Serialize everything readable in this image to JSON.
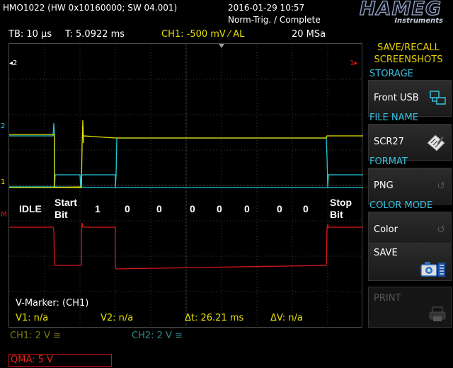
{
  "header": {
    "device": "HMO1022 (HW 0x10160000; SW 04.001)",
    "datetime": "2016-01-29 10:57",
    "trigger": "Norm-Trig. / Complete",
    "brand": "HAMEG",
    "brand_sub": "Instruments"
  },
  "status": {
    "timebase": "TB: 10 µs",
    "time": "T: 5.0922 ms",
    "ch1": "CH1: -500 mV ⁄ AL",
    "sample_rate": "20 MSa"
  },
  "markers": {
    "ref2": "◂2",
    "ref1": "1▸",
    "ch2_marker": "2",
    "ch1_marker": "1",
    "math_marker": "M"
  },
  "bits": {
    "idle": "IDLE",
    "start_1": "Start",
    "start_2": "Bit",
    "b1": "1",
    "b2": "0",
    "b3": "0",
    "b4": "0",
    "b5": "0",
    "b6": "0",
    "b7": "0",
    "b8": "0",
    "stop_1": "Stop",
    "stop_2": "Bit"
  },
  "vmarker": {
    "title": "V-Marker: (CH1)",
    "v1": "V1: n/a",
    "v2": "V2: n/a",
    "dt": "Δt: 26.21 ms",
    "dv": "ΔV: n/a"
  },
  "bottom": {
    "ch1": "CH1: 2 V ≅",
    "ch2": "CH2: 2 V ≅",
    "qma": "QMA: 5 V"
  },
  "menu": {
    "title": "SAVE/RECALL SCREENSHOTS",
    "storage_head": "STORAGE",
    "storage_value": "Front USB",
    "filename_head": "FILE NAME",
    "filename_value": "SCR27",
    "format_head": "FORMAT",
    "format_value": "PNG",
    "color_head": "COLOR MODE",
    "color_value": "Color",
    "save_label": "SAVE",
    "print_label": "PRINT"
  },
  "colors": {
    "ch1": "#e8e000",
    "ch2": "#20c8d8",
    "math": "#d81818",
    "menu_head": "#39c0e0",
    "menu_title": "#e8d000"
  }
}
